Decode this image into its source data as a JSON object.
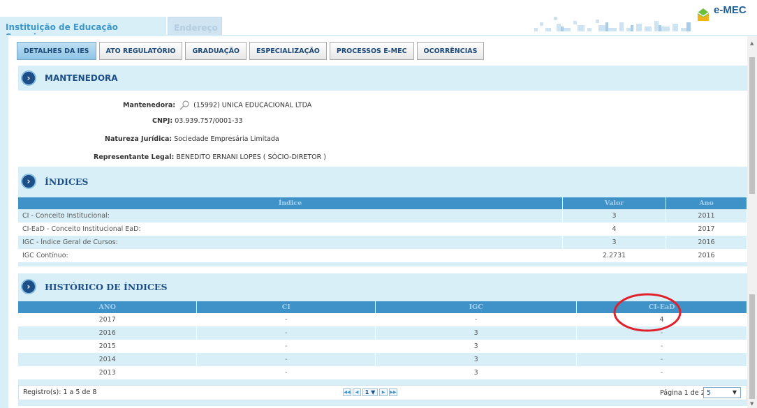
{
  "tabs": [
    {
      "label": "Instituição de Educação Superior"
    },
    {
      "label": "Endereço"
    }
  ],
  "brand": {
    "name": "e-MEC"
  },
  "toolbar": {
    "buttons": [
      {
        "label": "DETALHES DA IES"
      },
      {
        "label": "ATO REGULATÓRIO"
      },
      {
        "label": "GRADUAÇÃO"
      },
      {
        "label": "ESPECIALIZAÇÃO"
      },
      {
        "label": "PROCESSOS E-MEC"
      },
      {
        "label": "OCORRÊNCIAS"
      }
    ]
  },
  "mantenedora": {
    "section_title": "MANTENEDORA",
    "fields": [
      {
        "label": "Mantenedora:",
        "value": "(15992) UNICA EDUCACIONAL LTDA"
      },
      {
        "label": "CNPJ:",
        "value": "03.939.757/0001-33"
      },
      {
        "label": "Natureza Jurídica:",
        "value": "Sociedade Empresária Limitada"
      },
      {
        "label": "Representante Legal:",
        "value": "BENEDITO ERNANI LOPES ( SÓCIO-DIRETOR )"
      }
    ]
  },
  "indices": {
    "section_title": "ÍNDICES",
    "headers": [
      "Índice",
      "Valor",
      "Ano"
    ],
    "rows": [
      [
        "CI - Conceito Institucional:",
        "3",
        "2011"
      ],
      [
        "CI-EaD - Conceito Institucional EaD:",
        "4",
        "2017"
      ],
      [
        "IGC - Índice Geral de Cursos:",
        "3",
        "2016"
      ],
      [
        "IGC Contínuo:",
        "2.2731",
        "2016"
      ]
    ]
  },
  "historico": {
    "section_title": "HISTÓRICO DE ÍNDICES",
    "headers": [
      "ANO",
      "CI",
      "IGC",
      "CI-EaD"
    ],
    "rows": [
      [
        "2017",
        "-",
        "-",
        "4"
      ],
      [
        "2016",
        "-",
        "3",
        "-"
      ],
      [
        "2015",
        "-",
        "3",
        "-"
      ],
      [
        "2014",
        "-",
        "3",
        "-"
      ],
      [
        "2013",
        "-",
        "3",
        "-"
      ]
    ],
    "records_text": "Registro(s): 1 a 5 de 8",
    "current_page": "1",
    "page_info": "Página 1 de 2",
    "per_page": "5"
  },
  "colors": {
    "accent": "#3f92c8",
    "header_dark": "#1c4f88",
    "panel": "#d8eff8",
    "highlight_circle": "#e0202a"
  }
}
